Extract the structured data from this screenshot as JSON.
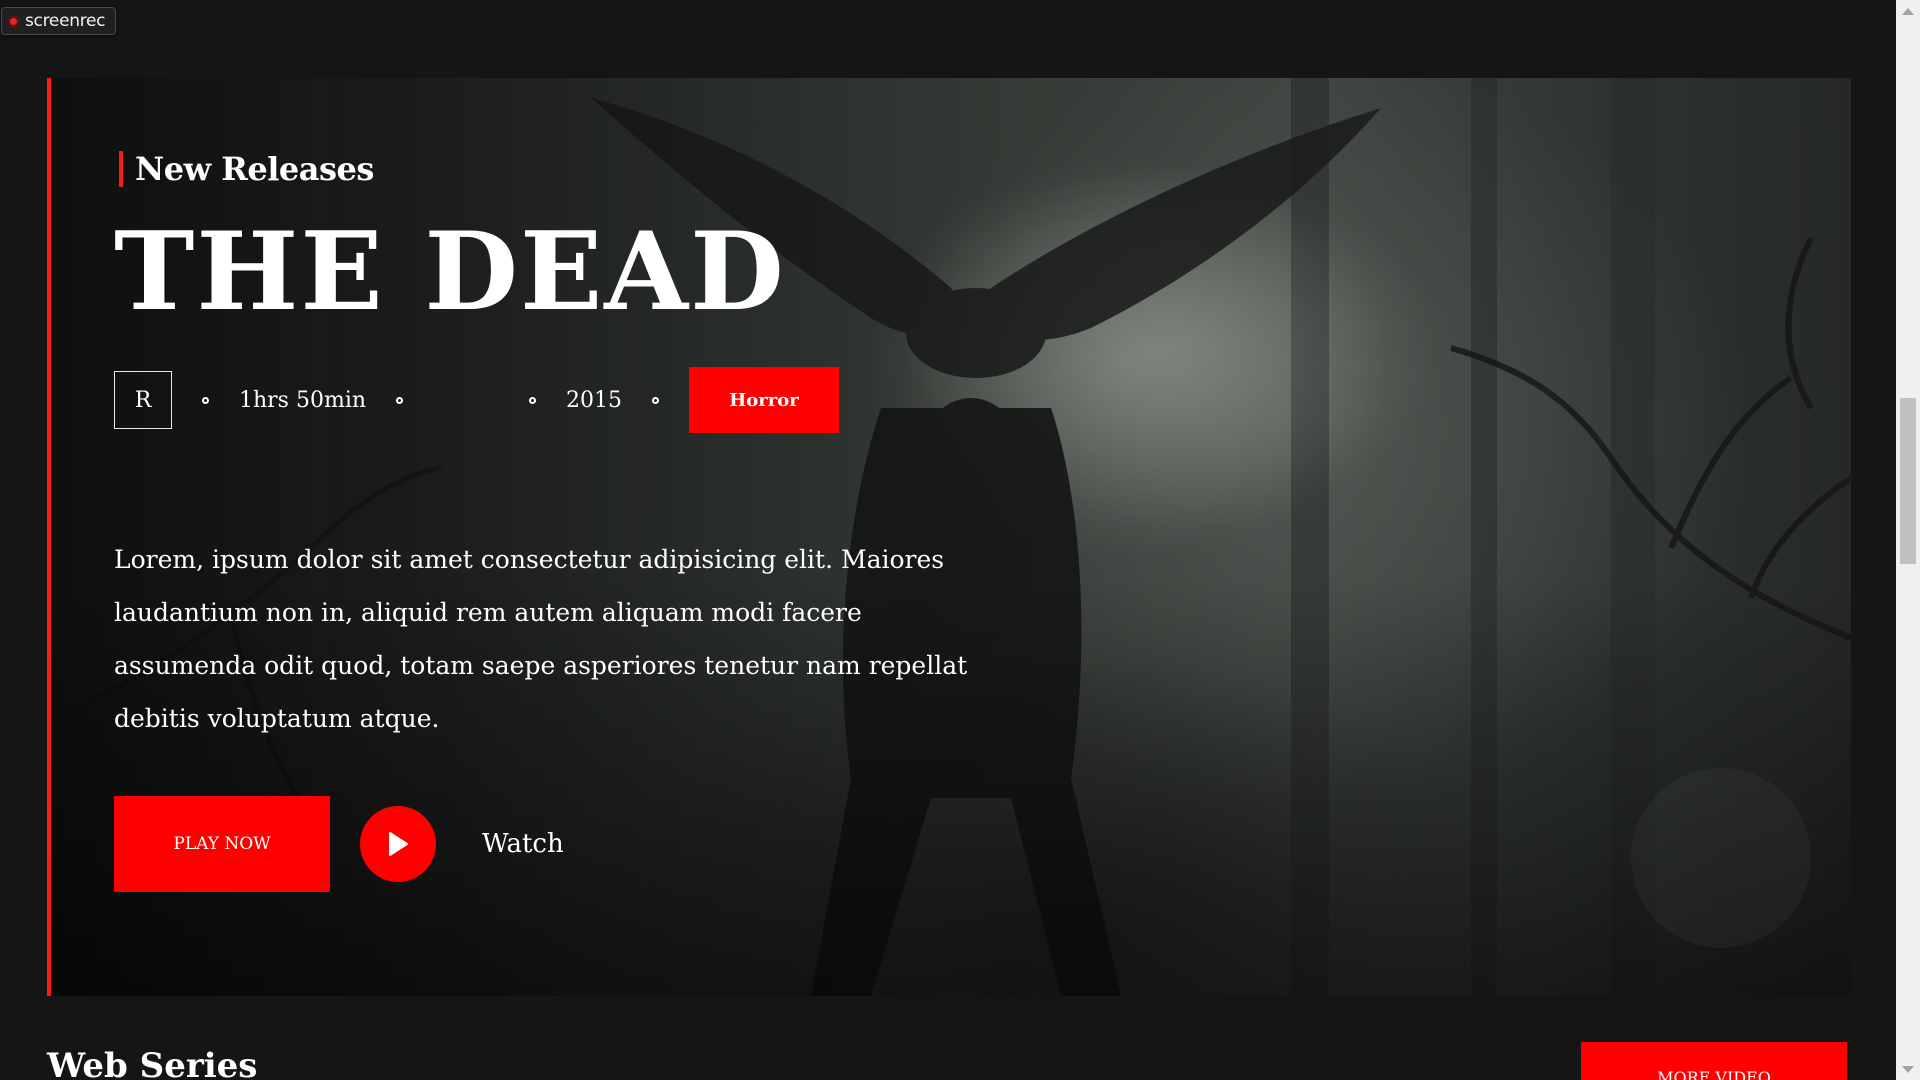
{
  "overlay": {
    "recorder_label": "screenrec",
    "recorder_icon": "record-dot-icon"
  },
  "hero": {
    "kicker": "New Releases",
    "title": "THE DEAD",
    "meta": {
      "rating": "R",
      "duration": "1hrs 50min",
      "year": "2015",
      "genre": "Horror"
    },
    "description": "Lorem, ipsum dolor sit amet consectetur adipisicing elit. Maiores laudantium non in, aliquid rem autem aliquam modi facere assumenda odit quod, totam saepe asperiores tenetur nam repellat debitis voluptatum atque.",
    "play_now_label": "PLAY NOW",
    "watch_label": "Watch",
    "watch_icon": "play-icon"
  },
  "web_series": {
    "title": "Web Series",
    "more_label": "MORE VIDEO"
  },
  "colors": {
    "accent": "#ff0000",
    "background": "#151515"
  }
}
